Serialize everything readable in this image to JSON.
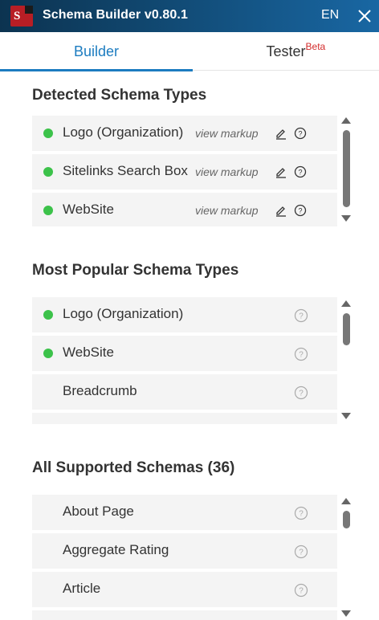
{
  "app": {
    "logo_letter": "S",
    "title": "Schema Builder v0.80.1",
    "language": "EN"
  },
  "tabs": {
    "builder": "Builder",
    "tester": "Tester",
    "tester_badge": "Beta"
  },
  "detected": {
    "title": "Detected Schema Types",
    "items": [
      {
        "label": "Logo (Organization)",
        "action": "view markup",
        "status": "active"
      },
      {
        "label": "Sitelinks Search Box",
        "action": "view markup",
        "status": "active"
      },
      {
        "label": "WebSite",
        "action": "view markup",
        "status": "active"
      }
    ]
  },
  "popular": {
    "title": "Most Popular Schema Types",
    "items": [
      {
        "label": "Logo (Organization)",
        "status": "active"
      },
      {
        "label": "WebSite",
        "status": "active"
      },
      {
        "label": "Breadcrumb",
        "status": "none"
      }
    ]
  },
  "supported": {
    "title": "All Supported Schemas (36)",
    "items": [
      {
        "label": "About Page"
      },
      {
        "label": "Aggregate Rating"
      },
      {
        "label": "Article"
      }
    ]
  },
  "colors": {
    "accent": "#1c7cc0",
    "status_active": "#3cc24a",
    "beta": "#d32a2a",
    "titlebar": "#114a74"
  },
  "icons": [
    "close-icon",
    "edit-icon",
    "help-icon",
    "scroll-up-icon",
    "scroll-down-icon"
  ]
}
